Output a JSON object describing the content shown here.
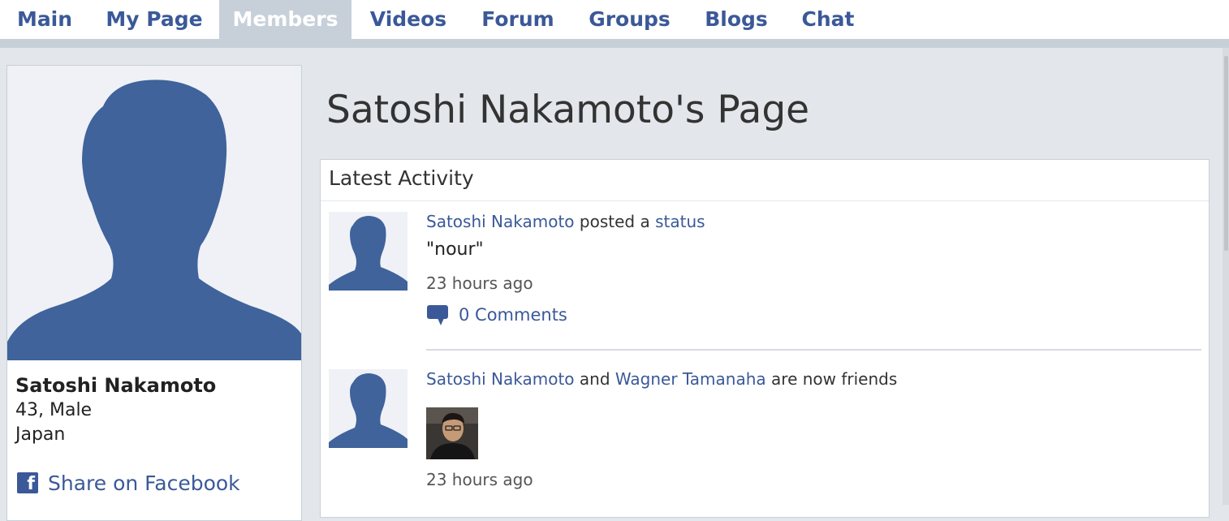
{
  "nav": {
    "tabs": [
      {
        "label": "Main",
        "active": false
      },
      {
        "label": "My Page",
        "active": false
      },
      {
        "label": "Members",
        "active": true
      },
      {
        "label": "Videos",
        "active": false
      },
      {
        "label": "Forum",
        "active": false
      },
      {
        "label": "Groups",
        "active": false
      },
      {
        "label": "Blogs",
        "active": false
      },
      {
        "label": "Chat",
        "active": false
      }
    ]
  },
  "profile": {
    "avatar_icon": "default-silhouette-icon",
    "name": "Satoshi Nakamoto",
    "age_gender": "43, Male",
    "location": "Japan",
    "share_label": "Share on Facebook",
    "share_icon": "facebook-icon"
  },
  "page_title": "Satoshi Nakamoto's Page",
  "activity": {
    "title": "Latest Activity",
    "items": [
      {
        "actor": "Satoshi Nakamoto",
        "verb": " posted a ",
        "object": "status",
        "quote": "\"nour\"",
        "time": "23 hours ago",
        "comments": "0 Comments",
        "comment_icon": "speech-bubble-icon"
      },
      {
        "actor": "Satoshi Nakamoto",
        "joiner": " and ",
        "friend": "Wagner Tamanaha",
        "tail": " are now friends",
        "time": "23 hours ago"
      }
    ]
  },
  "colors": {
    "brand": "#3b5998",
    "nav_active_bg": "#c7d0d9",
    "page_bg": "#e3e6ea"
  }
}
